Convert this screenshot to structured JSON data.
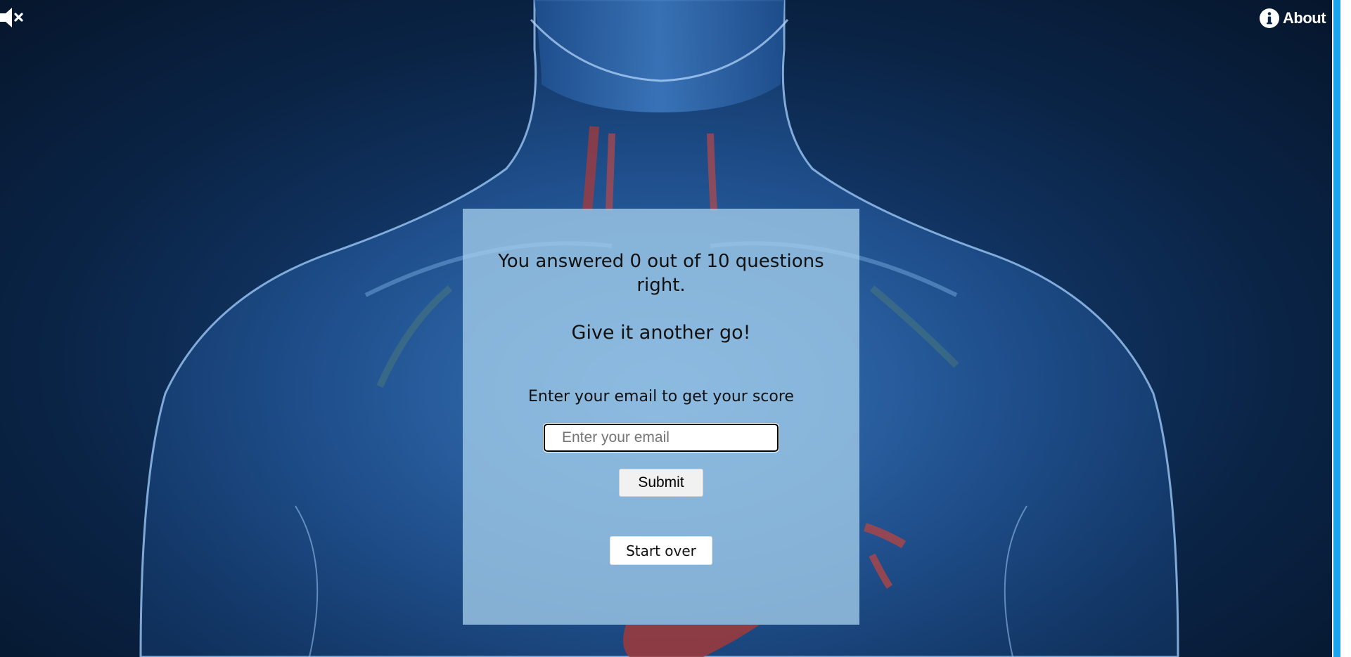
{
  "top_bar": {
    "mute_icon": "speaker-muted-icon",
    "about_icon": "info-circle-icon",
    "about_label": "About"
  },
  "result_panel": {
    "result_text": "You answered 0 out of 10 questions right.",
    "encouragement": "Give it another go!",
    "email_prompt": "Enter your email to get your score",
    "email_input": {
      "value": "",
      "placeholder": "Enter your email"
    },
    "submit_label": "Submit",
    "start_over_label": "Start over"
  },
  "colors": {
    "panel_background": "#a3cdea",
    "scrollbar_accent": "#1aa3ee",
    "background_dark": "#06162c",
    "background_body": "#1d4c85"
  }
}
